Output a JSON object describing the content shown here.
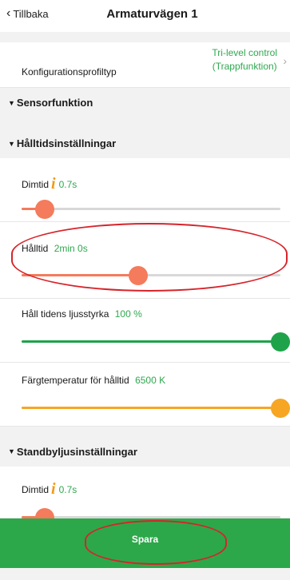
{
  "header": {
    "back_label": "Tillbaka",
    "title": "Armaturvägen 1"
  },
  "config": {
    "label": "Konfigurationsprofiltyp",
    "value_line1": "Tri-level control",
    "value_line2": "(Trappfunktion)"
  },
  "sections": {
    "sensor": "Sensorfunktion",
    "hold": "Hålltidsinställningar",
    "standby": "Standbyljusinställningar"
  },
  "sliders": {
    "dimtid": {
      "label": "Dimtid",
      "value": "0.7s",
      "level": 0.09,
      "color": "#f47b5c"
    },
    "halltid": {
      "label": "Hålltid",
      "value": "2min 0s",
      "level": 0.45,
      "color": "#f47b5c"
    },
    "ljusstyrka": {
      "label": "Håll tidens ljusstyrka",
      "value": "100 %",
      "level": 1.0,
      "color": "#1ea34a"
    },
    "fargtemp": {
      "label": "Färgtemperatur för hålltid",
      "value": "6500 K",
      "level": 1.0,
      "color": "#f6a623"
    },
    "standby_dimtid": {
      "label": "Dimtid",
      "value": "0.7s",
      "level": 0.09,
      "color": "#f47b5c"
    }
  },
  "save_label": "Spara",
  "colors": {
    "accent_green": "#2ca84a",
    "value_green": "#2fa84f",
    "info_orange": "#f29a12",
    "highlight_red": "#d6242b"
  },
  "icons": {
    "back": "chevron-left-icon",
    "info": "info-icon",
    "row_arrow": "chevron-right-icon",
    "section_toggle": "triangle-down-icon"
  }
}
